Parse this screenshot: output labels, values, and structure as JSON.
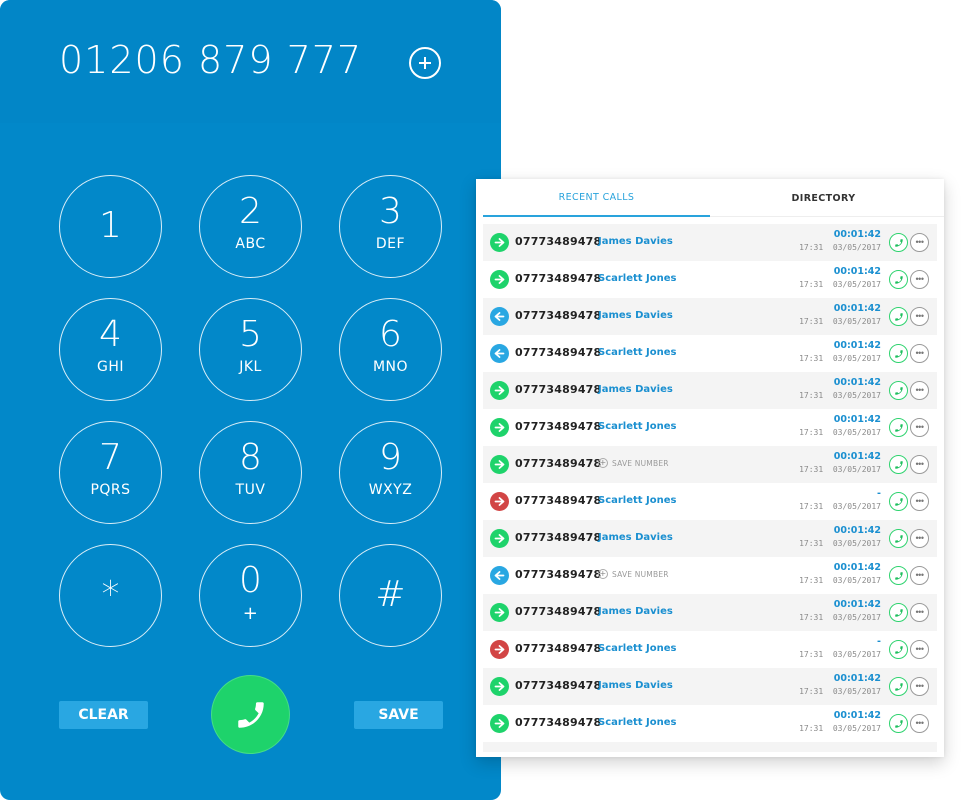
{
  "dialer": {
    "number": "01206 879 777",
    "add_contact_icon": "plus-circle-icon",
    "keys": [
      {
        "digit": "1",
        "letters": ""
      },
      {
        "digit": "2",
        "letters": "ABC"
      },
      {
        "digit": "3",
        "letters": "DEF"
      },
      {
        "digit": "4",
        "letters": "GHI"
      },
      {
        "digit": "5",
        "letters": "JKL"
      },
      {
        "digit": "6",
        "letters": "MNO"
      },
      {
        "digit": "7",
        "letters": "PQRS"
      },
      {
        "digit": "8",
        "letters": "TUV"
      },
      {
        "digit": "9",
        "letters": "WXYZ"
      },
      {
        "digit": "*",
        "letters": ""
      },
      {
        "digit": "0",
        "letters": "+"
      },
      {
        "digit": "#",
        "letters": ""
      }
    ],
    "clear_label": "CLEAR",
    "save_label": "SAVE",
    "call_icon": "phone-icon"
  },
  "colors": {
    "dialer_bg": "#0288c9",
    "accent_blue": "#29a3dc",
    "call_green": "#1ed36b",
    "outgoing": "#1ed36b",
    "incoming": "#29a7e2",
    "missed": "#d24545"
  },
  "panel": {
    "tabs": [
      {
        "label": "RECENT CALLS",
        "active": true
      },
      {
        "label": "DIRECTORY",
        "active": false
      }
    ],
    "save_number_label": "SAVE NUMBER",
    "calls": [
      {
        "direction": "outgoing",
        "number": "07773489478",
        "contact": "James Davies",
        "duration": "00:01:42",
        "time": "17:31",
        "date": "03/05/2017"
      },
      {
        "direction": "outgoing",
        "number": "07773489478",
        "contact": "Scarlett Jones",
        "duration": "00:01:42",
        "time": "17:31",
        "date": "03/05/2017"
      },
      {
        "direction": "incoming",
        "number": "07773489478",
        "contact": "James Davies",
        "duration": "00:01:42",
        "time": "17:31",
        "date": "03/05/2017"
      },
      {
        "direction": "incoming",
        "number": "07773489478",
        "contact": "Scarlett Jones",
        "duration": "00:01:42",
        "time": "17:31",
        "date": "03/05/2017"
      },
      {
        "direction": "outgoing",
        "number": "07773489478",
        "contact": "James Davies",
        "duration": "00:01:42",
        "time": "17:31",
        "date": "03/05/2017"
      },
      {
        "direction": "outgoing",
        "number": "07773489478",
        "contact": "Scarlett Jones",
        "duration": "00:01:42",
        "time": "17:31",
        "date": "03/05/2017"
      },
      {
        "direction": "outgoing",
        "number": "07773489478",
        "contact": null,
        "duration": "00:01:42",
        "time": "17:31",
        "date": "03/05/2017"
      },
      {
        "direction": "missed",
        "number": "07773489478",
        "contact": "Scarlett Jones",
        "duration": "-",
        "time": "17:31",
        "date": "03/05/2017"
      },
      {
        "direction": "outgoing",
        "number": "07773489478",
        "contact": "James Davies",
        "duration": "00:01:42",
        "time": "17:31",
        "date": "03/05/2017"
      },
      {
        "direction": "incoming",
        "number": "07773489478",
        "contact": null,
        "duration": "00:01:42",
        "time": "17:31",
        "date": "03/05/2017"
      },
      {
        "direction": "outgoing",
        "number": "07773489478",
        "contact": "James Davies",
        "duration": "00:01:42",
        "time": "17:31",
        "date": "03/05/2017"
      },
      {
        "direction": "missed",
        "number": "07773489478",
        "contact": "Scarlett Jones",
        "duration": "-",
        "time": "17:31",
        "date": "03/05/2017"
      },
      {
        "direction": "outgoing",
        "number": "07773489478",
        "contact": "James Davies",
        "duration": "00:01:42",
        "time": "17:31",
        "date": "03/05/2017"
      },
      {
        "direction": "outgoing",
        "number": "07773489478",
        "contact": "Scarlett Jones",
        "duration": "00:01:42",
        "time": "17:31",
        "date": "03/05/2017"
      }
    ]
  }
}
